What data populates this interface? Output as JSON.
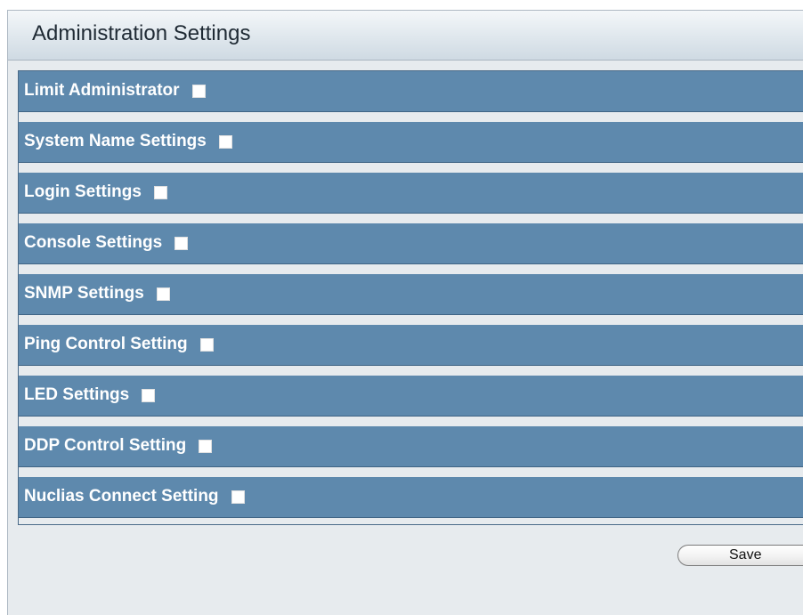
{
  "header": {
    "title": "Administration Settings"
  },
  "settings": {
    "items": [
      {
        "label": "Limit Administrator",
        "checked": false
      },
      {
        "label": "System Name Settings",
        "checked": false
      },
      {
        "label": "Login Settings",
        "checked": false
      },
      {
        "label": "Console Settings",
        "checked": false
      },
      {
        "label": "SNMP Settings",
        "checked": false
      },
      {
        "label": "Ping Control Setting",
        "checked": false
      },
      {
        "label": "LED Settings",
        "checked": false
      },
      {
        "label": "DDP Control Setting",
        "checked": false
      },
      {
        "label": "Nuclias Connect Setting",
        "checked": false
      }
    ]
  },
  "actions": {
    "save_label": "Save"
  },
  "colors": {
    "row_background": "#5e89ad",
    "panel_background": "#e7ebee",
    "label_text": "#ffffff"
  }
}
